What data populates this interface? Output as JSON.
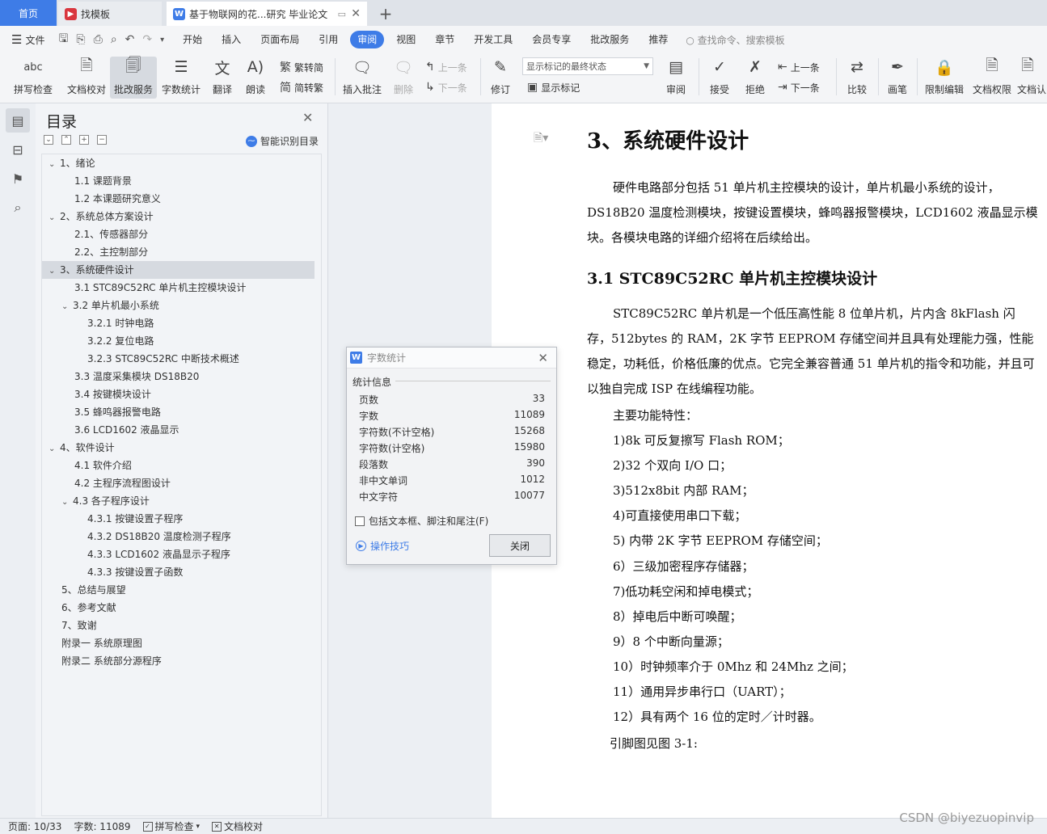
{
  "tabs": {
    "home": "首页",
    "template": "找模板",
    "doc": "基于物联网的花...研究 毕业论文",
    "new_tab": "+",
    "close": "✕"
  },
  "menubar": {
    "file": "文件",
    "items": [
      "开始",
      "插入",
      "页面布局",
      "引用",
      "审阅",
      "视图",
      "章节",
      "开发工具",
      "会员专享",
      "批改服务",
      "推荐"
    ],
    "active": "审阅",
    "search": "查找命令、搜索模板"
  },
  "ribbon": {
    "spell": "拼写检查",
    "proofread": "文档校对",
    "correction": "批改服务",
    "word_count": "字数统计",
    "translate": "翻译",
    "read_aloud": "朗读",
    "trad_to_simp": "繁转简",
    "simp_to_trad": "简转繁",
    "insert_comment": "插入批注",
    "delete": "删除",
    "prev_comment": "上一条",
    "next_comment": "下一条",
    "track_changes": "修订",
    "display_state": "显示标记的最终状态",
    "show_markup": "显示标记",
    "review": "审阅",
    "accept": "接受",
    "reject": "拒绝",
    "prev_change": "上一条",
    "next_change": "下一条",
    "compare": "比较",
    "pen": "画笔",
    "restrict_edit": "限制编辑",
    "doc_permission": "文档权限",
    "doc_cert": "文档认"
  },
  "toc": {
    "title": "目录",
    "close": "✕",
    "smart": "智能识别目录",
    "items": [
      {
        "text": "1、绪论",
        "level": 1,
        "caret": "⌄"
      },
      {
        "text": "1.1 课题背景",
        "level": 2,
        "caret": ""
      },
      {
        "text": "1.2  本课题研究意义",
        "level": 2,
        "caret": ""
      },
      {
        "text": "2、系统总体方案设计",
        "level": 1,
        "caret": "⌄"
      },
      {
        "text": "2.1、传感器部分",
        "level": 2,
        "caret": ""
      },
      {
        "text": "2.2、主控制部分",
        "level": 2,
        "caret": ""
      },
      {
        "text": "3、系统硬件设计",
        "level": 1,
        "caret": "⌄",
        "selected": true
      },
      {
        "text": "3.1 STC89C52RC 单片机主控模块设计",
        "level": 2,
        "caret": ""
      },
      {
        "text": "3.2 单片机最小系统",
        "level": 2,
        "caret": "⌄"
      },
      {
        "text": "3.2.1 时钟电路",
        "level": 3,
        "caret": ""
      },
      {
        "text": "3.2.2 复位电路",
        "level": 3,
        "caret": ""
      },
      {
        "text": "3.2.3 STC89C52RC 中断技术概述",
        "level": 3,
        "caret": ""
      },
      {
        "text": "3.3  温度采集模块 DS18B20",
        "level": 2,
        "caret": ""
      },
      {
        "text": "3.4 按键模块设计",
        "level": 2,
        "caret": ""
      },
      {
        "text": "3.5 蜂鸣器报警电路",
        "level": 2,
        "caret": ""
      },
      {
        "text": "3.6 LCD1602 液晶显示",
        "level": 2,
        "caret": ""
      },
      {
        "text": "4、软件设计",
        "level": 1,
        "caret": "⌄"
      },
      {
        "text": "4.1 软件介绍",
        "level": 2,
        "caret": ""
      },
      {
        "text": "4.2  主程序流程图设计",
        "level": 2,
        "caret": ""
      },
      {
        "text": "4.3 各子程序设计",
        "level": 2,
        "caret": "⌄"
      },
      {
        "text": "4.3.1 按键设置子程序",
        "level": 3,
        "caret": ""
      },
      {
        "text": "4.3.2 DS18B20 温度检测子程序",
        "level": 3,
        "caret": ""
      },
      {
        "text": "4.3.3 LCD1602 液晶显示子程序",
        "level": 3,
        "caret": ""
      },
      {
        "text": "4.3.3  按键设置子函数",
        "level": 3,
        "caret": ""
      },
      {
        "text": "5、总结与展望",
        "level": 1,
        "caret": ""
      },
      {
        "text": "6、参考文献",
        "level": 1,
        "caret": ""
      },
      {
        "text": "7、致谢",
        "level": 1,
        "caret": ""
      },
      {
        "text": "附录一  系统原理图",
        "level": 1,
        "caret": ""
      },
      {
        "text": "附录二  系统部分源程序",
        "level": 1,
        "caret": ""
      }
    ]
  },
  "doc": {
    "h1": "3、系统硬件设计",
    "p1": "硬件电路部分包括 51 单片机主控模块的设计，单片机最小系统的设计，DS18B20 温度检测模块，按键设置模块，蜂鸣器报警模块，LCD1602 液晶显示模块。各模块电路的详细介绍将在后续给出。",
    "h2": "3.1 STC89C52RC 单片机主控模块设计",
    "p2": "STC89C52RC 单片机是一个低压高性能 8 位单片机，片内含 8kFlash 闪存，512bytes 的 RAM，2K 字节 EEPROM 存储空间并且具有处理能力强，性能稳定，功耗低，价格低廉的优点。它完全兼容普通 51 单片机的指令和功能，并且可以独自完成 ISP 在线编程功能。",
    "features_title": "主要功能特性：",
    "features": [
      "1)8k 可反复擦写 Flash ROM；",
      "2)32 个双向 I/O 口；",
      "3)512x8bit 内部 RAM；",
      "4)可直接使用串口下载；",
      "5) 内带 2K 字节 EEPROM 存储空间；",
      "6）三级加密程序存储器；",
      "7)低功耗空闲和掉电模式；",
      "8）掉电后中断可唤醒；",
      "9）8 个中断向量源；",
      "10）时钟频率介于 0Mhz 和 24Mhz 之间；",
      "11）通用异步串行口（UART）；",
      "12）具有两个 16 位的定时／计时器。"
    ],
    "last": "引脚图见图 3-1:"
  },
  "dialog": {
    "title": "字数统计",
    "section": "统计信息",
    "rows": [
      {
        "label": "页数",
        "value": "33"
      },
      {
        "label": "字数",
        "value": "11089"
      },
      {
        "label": "字符数(不计空格)",
        "value": "15268"
      },
      {
        "label": "字符数(计空格)",
        "value": "15980"
      },
      {
        "label": "段落数",
        "value": "390"
      },
      {
        "label": "非中文单词",
        "value": "1012"
      },
      {
        "label": "中文字符",
        "value": "10077"
      }
    ],
    "checkbox": "包括文本框、脚注和尾注(F)",
    "tips": "操作技巧",
    "close_btn": "关闭"
  },
  "status": {
    "page": "页面: 10/33",
    "words": "字数: 11089",
    "spell": "拼写检查",
    "proof": "文档校对"
  },
  "watermark": "CSDN @biyezuopinvip",
  "colors": {
    "accent": "#3e7ce7",
    "wps_red": "#d9363e"
  }
}
